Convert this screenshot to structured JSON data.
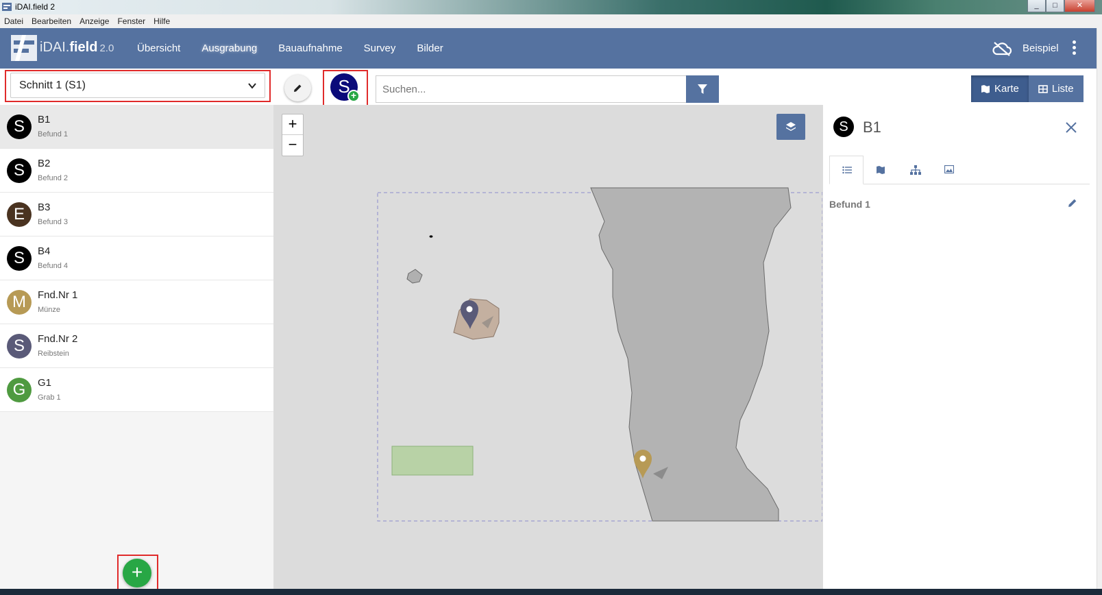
{
  "window": {
    "title": "iDAI.field 2"
  },
  "menu": [
    "Datei",
    "Bearbeiten",
    "Anzeige",
    "Fenster",
    "Hilfe"
  ],
  "brand": {
    "prefix": "iDAI.",
    "name": "field",
    "version": "2.0"
  },
  "nav": [
    {
      "label": "Übersicht",
      "active": false
    },
    {
      "label": "Ausgrabung",
      "active": true
    },
    {
      "label": "Bauaufnahme",
      "active": false
    },
    {
      "label": "Survey",
      "active": false
    },
    {
      "label": "Bilder",
      "active": false
    }
  ],
  "project": "Beispiel",
  "toolbar": {
    "operation_select": "Schnitt 1 (S1)",
    "add_type_letter": "S",
    "search_placeholder": "Suchen...",
    "view_map": "Karte",
    "view_list": "Liste"
  },
  "list": [
    {
      "letter": "S",
      "color": "#000000",
      "identifier": "B1",
      "short": "Befund 1",
      "selected": true
    },
    {
      "letter": "S",
      "color": "#000000",
      "identifier": "B2",
      "short": "Befund 2",
      "selected": false
    },
    {
      "letter": "E",
      "color": "#4a3320",
      "identifier": "B3",
      "short": "Befund 3",
      "selected": false
    },
    {
      "letter": "S",
      "color": "#000000",
      "identifier": "B4",
      "short": "Befund 4",
      "selected": false
    },
    {
      "letter": "M",
      "color": "#b79a55",
      "identifier": "Fnd.Nr 1",
      "short": "Münze",
      "selected": false
    },
    {
      "letter": "S",
      "color": "#5a5a78",
      "identifier": "Fnd.Nr 2",
      "short": "Reibstein",
      "selected": false
    },
    {
      "letter": "G",
      "color": "#4f9a40",
      "identifier": "G1",
      "short": "Grab 1",
      "selected": false
    }
  ],
  "map": {
    "zoom_in": "+",
    "zoom_out": "−"
  },
  "panel": {
    "letter": "S",
    "title": "B1",
    "field_value": "Befund 1"
  },
  "fab_label": "+"
}
